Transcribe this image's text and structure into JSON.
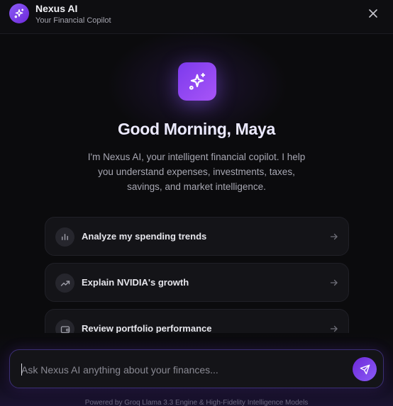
{
  "header": {
    "title": "Nexus AI",
    "subtitle": "Your Financial Copilot",
    "icon": "sparkles-icon",
    "close_icon": "close-icon"
  },
  "hero": {
    "icon": "sparkles-icon",
    "greeting": "Good Morning, Maya",
    "intro": "I'm Nexus AI, your intelligent financial copilot. I help you understand expenses, investments, taxes, savings, and market intelligence."
  },
  "suggestions": [
    {
      "label": "Analyze my spending trends",
      "icon": "bar-chart-icon"
    },
    {
      "label": "Explain NVIDIA's growth",
      "icon": "trending-up-icon"
    },
    {
      "label": "Review portfolio performance",
      "icon": "wallet-icon"
    }
  ],
  "composer": {
    "placeholder": "Ask Nexus AI anything about your finances...",
    "value": "",
    "send_icon": "send-icon"
  },
  "footer": {
    "note": "Powered by Groq Llama 3.3 Engine & High-Fidelity Intelligence Models"
  },
  "colors": {
    "accent": "#8b5cf6",
    "accent_dark": "#6d28d9",
    "background": "#0b0b0d",
    "card": "#141418"
  }
}
